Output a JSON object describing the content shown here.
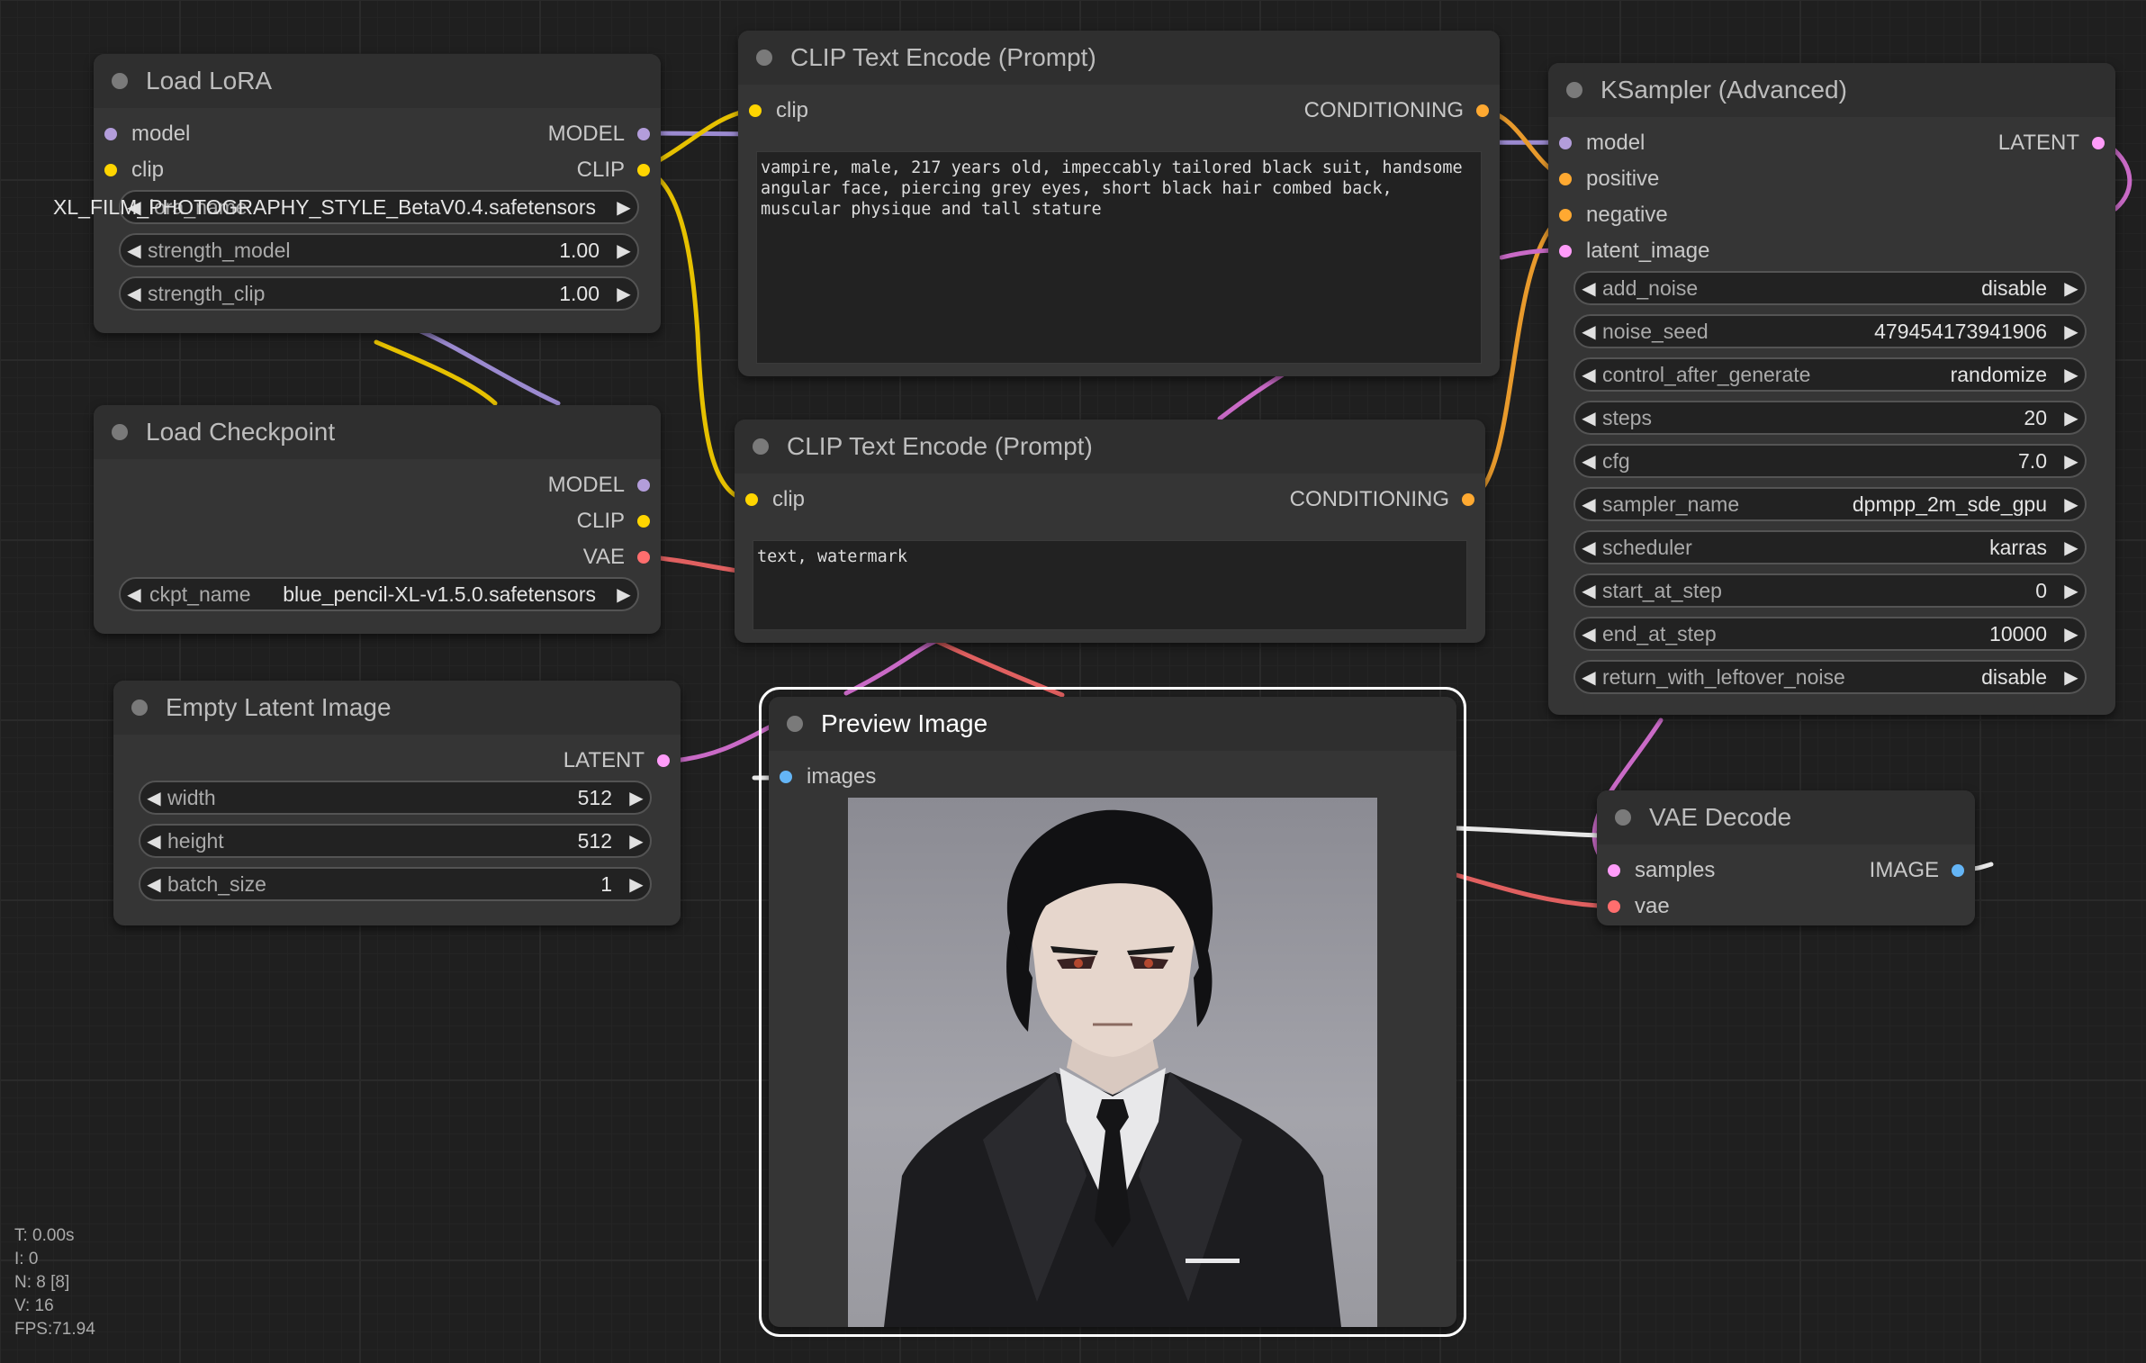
{
  "colors": {
    "model": "#b39ddb",
    "clip": "#ffd500",
    "conditioning": "#ffa931",
    "latent": "#ff9cf9",
    "vae": "#ff6e6e",
    "image": "#64b5f6"
  },
  "nodes": {
    "load_lora": {
      "title": "Load LoRA",
      "inputs": [
        "model",
        "clip"
      ],
      "outputs": [
        "MODEL",
        "CLIP"
      ],
      "lora_name_value": "XL_FILM_PHOTOGRAPHY_STYLE_BetaV0.4.safetensors",
      "lora_name_label": "lora_name",
      "strength_model": {
        "name": "strength_model",
        "value": "1.00"
      },
      "strength_clip": {
        "name": "strength_clip",
        "value": "1.00"
      }
    },
    "load_checkpoint": {
      "title": "Load Checkpoint",
      "outputs": [
        "MODEL",
        "CLIP",
        "VAE"
      ],
      "ckpt_name": {
        "name": "ckpt_name",
        "value": "blue_pencil-XL-v1.5.0.safetensors"
      }
    },
    "empty_latent": {
      "title": "Empty Latent Image",
      "outputs": [
        "LATENT"
      ],
      "widgets": [
        {
          "name": "width",
          "value": "512"
        },
        {
          "name": "height",
          "value": "512"
        },
        {
          "name": "batch_size",
          "value": "1"
        }
      ]
    },
    "clip_pos": {
      "title": "CLIP Text Encode (Prompt)",
      "input": "clip",
      "output": "CONDITIONING",
      "text": "vampire, male, 217 years old, impeccably tailored black suit, handsome angular face, piercing grey eyes, short black hair combed back, muscular physique and tall stature"
    },
    "clip_neg": {
      "title": "CLIP Text Encode (Prompt)",
      "input": "clip",
      "output": "CONDITIONING",
      "text": "text, watermark"
    },
    "preview": {
      "title": "Preview Image",
      "input": "images"
    },
    "ksampler": {
      "title": "KSampler (Advanced)",
      "inputs": [
        "model",
        "positive",
        "negative",
        "latent_image"
      ],
      "output": "LATENT",
      "widgets": [
        {
          "name": "add_noise",
          "value": "disable"
        },
        {
          "name": "noise_seed",
          "value": "479454173941906"
        },
        {
          "name": "control_after_generate",
          "value": "randomize"
        },
        {
          "name": "steps",
          "value": "20"
        },
        {
          "name": "cfg",
          "value": "7.0"
        },
        {
          "name": "sampler_name",
          "value": "dpmpp_2m_sde_gpu"
        },
        {
          "name": "scheduler",
          "value": "karras"
        },
        {
          "name": "start_at_step",
          "value": "0"
        },
        {
          "name": "end_at_step",
          "value": "10000"
        },
        {
          "name": "return_with_leftover_noise",
          "value": "disable"
        }
      ]
    },
    "vae_decode": {
      "title": "VAE Decode",
      "inputs": [
        "samples",
        "vae"
      ],
      "output": "IMAGE"
    }
  },
  "stats": {
    "t": "T: 0.00s",
    "i": "I: 0",
    "n": "N: 8 [8]",
    "v": "V: 16",
    "fps": "FPS:71.94"
  }
}
